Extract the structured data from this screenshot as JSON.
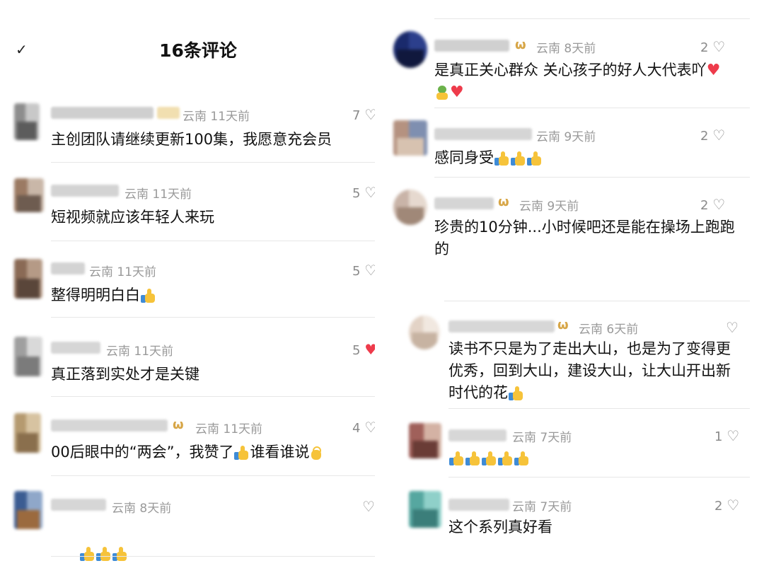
{
  "header": {
    "collapse_icon": "✓",
    "title": "16条评论"
  },
  "colors": {
    "meta": "#9a9a9a",
    "like_active": "#ee3b4b",
    "badge": "#d7a647",
    "divider": "#e7e7e7"
  },
  "left_comments": [
    {
      "location": "云南",
      "time": "11天前",
      "likes": "7",
      "text": "主创团队请继续更新100集，我愿意充会员",
      "emojis": []
    },
    {
      "location": "云南",
      "time": "11天前",
      "likes": "5",
      "text": "短视频就应该年轻人来玩",
      "emojis": []
    },
    {
      "location": "云南",
      "time": "11天前",
      "likes": "5",
      "text": "整得明明白白",
      "emojis": [
        "thumbs-up"
      ]
    },
    {
      "location": "云南",
      "time": "11天前",
      "likes": "5",
      "text": "真正落到实处才是关键",
      "emojis": []
    },
    {
      "location": "云南",
      "time": "11天前",
      "likes": "4",
      "text": "00后眼中的“两会”，我赞了",
      "emojis": [
        "thumbs-up"
      ],
      "text2": "谁看谁说",
      "emojis2": [
        "ok-hand"
      ]
    },
    {
      "location": "云南",
      "time": "8天前",
      "likes": "",
      "text": "",
      "emojis": [
        "thumbs-up",
        "thumbs-up",
        "thumbs-up"
      ]
    }
  ],
  "right_comments": [
    {
      "location": "云南",
      "time": "8天前",
      "likes": "2",
      "text": "是真正关心群众 关心孩子的好人大代表吖",
      "emojis": [
        "red-heart"
      ],
      "line2_emojis": [
        "green-hug",
        "red-heart"
      ]
    },
    {
      "location": "云南",
      "time": "9天前",
      "likes": "2",
      "text": "感同身受",
      "emojis": [
        "thumbs-up",
        "thumbs-up",
        "thumbs-up"
      ]
    },
    {
      "location": "云南",
      "time": "9天前",
      "likes": "2",
      "text": "珍贵的10分钟...小时候吧还是能在操场上跑跑\n的",
      "emojis": []
    },
    {
      "location": "云南",
      "time": "6天前",
      "likes": "",
      "text": "读书不只是为了走出大山，也是为了变得更\n优秀，回到大山，建设大山，让大山开出新\n时代的花",
      "emojis": [
        "thumbs-up"
      ]
    },
    {
      "location": "云南",
      "time": "7天前",
      "likes": "1",
      "text": "",
      "emojis": [
        "thumbs-up",
        "thumbs-up",
        "thumbs-up",
        "thumbs-up",
        "thumbs-up"
      ]
    },
    {
      "location": "云南",
      "time": "7天前",
      "likes": "2",
      "text": "这个系列真好看",
      "emojis": []
    }
  ]
}
